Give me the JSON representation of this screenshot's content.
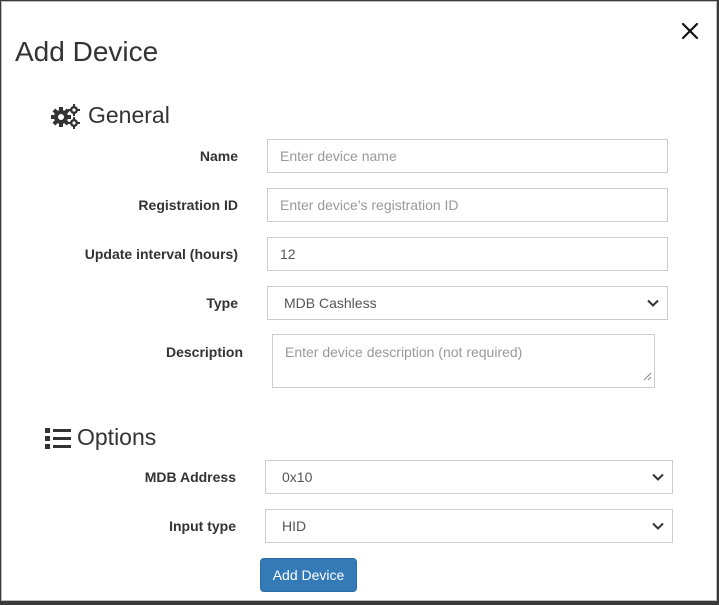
{
  "modal": {
    "title": "Add Device",
    "close_icon": "close-icon"
  },
  "general": {
    "heading": "General",
    "icon": "gears-icon",
    "name": {
      "label": "Name",
      "placeholder": "Enter device name"
    },
    "registration_id": {
      "label": "Registration ID",
      "placeholder": "Enter device's registration ID"
    },
    "update_interval": {
      "label": "Update interval (hours)",
      "value": "12"
    },
    "type": {
      "label": "Type",
      "selected": "MDB Cashless"
    },
    "description": {
      "label": "Description",
      "placeholder": "Enter device description (not required)"
    }
  },
  "options": {
    "heading": "Options",
    "icon": "list-icon",
    "mdb_address": {
      "label": "MDB Address",
      "selected": "0x10"
    },
    "input_type": {
      "label": "Input type",
      "selected": "HID"
    }
  },
  "actions": {
    "submit_label": "Add Device"
  }
}
